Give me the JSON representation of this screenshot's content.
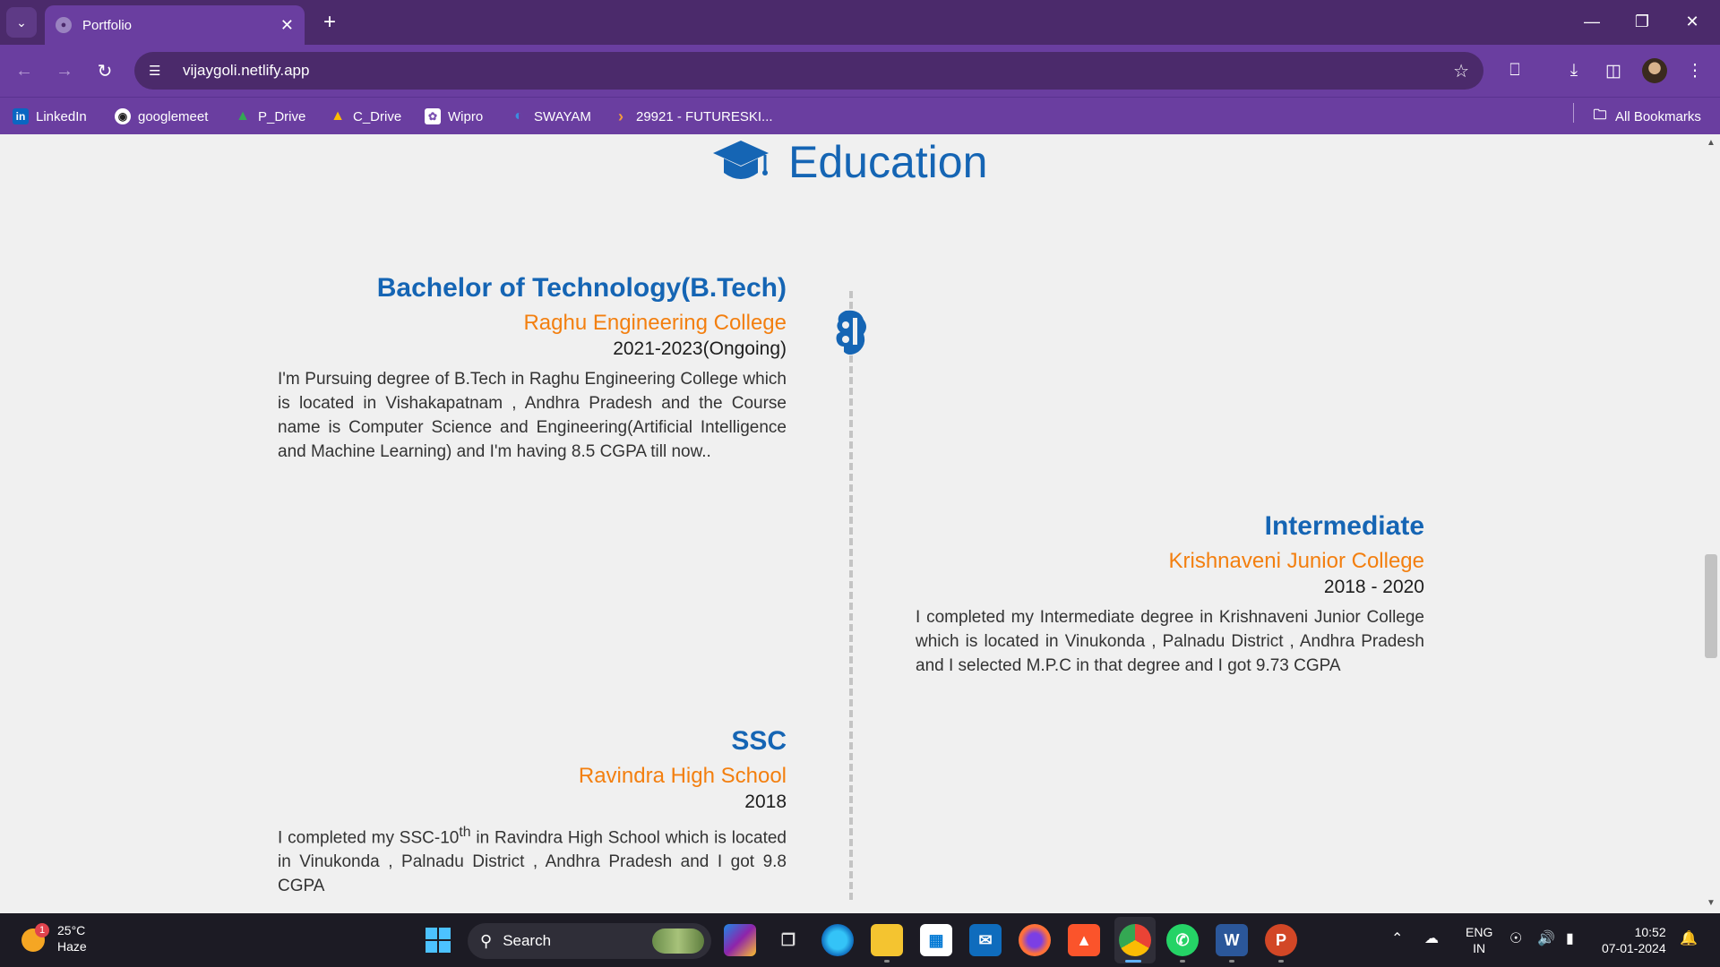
{
  "browser": {
    "tab_title": "Portfolio",
    "url": "vijaygoli.netlify.app",
    "bookmarks": [
      {
        "label": "LinkedIn",
        "icon": "linkedin-icon"
      },
      {
        "label": "googlemeet",
        "icon": "github-icon"
      },
      {
        "label": "P_Drive",
        "icon": "google-drive-icon"
      },
      {
        "label": "C_Drive",
        "icon": "google-drive-icon"
      },
      {
        "label": "Wipro",
        "icon": "wipro-icon"
      },
      {
        "label": "SWAYAM",
        "icon": "swayam-icon"
      },
      {
        "label": "29921 - FUTURESKI...",
        "icon": "chevron-right-icon"
      }
    ],
    "all_bookmarks_label": "All Bookmarks"
  },
  "page": {
    "section_title": "Education",
    "entries": [
      {
        "degree": "Bachelor of Technology(B.Tech)",
        "college": "Raghu Engineering College",
        "years": "2021-2023(Ongoing)",
        "description": "I'm Pursuing degree of B.Tech in Raghu Engineering College which is located in Vishakapatnam , Andhra Pradesh and the Course name is Computer Science and Engineering(Artificial Intelligence and Machine Learning) and I'm having 8.5 CGPA till now.."
      },
      {
        "degree": "Intermediate",
        "college": "Krishnaveni Junior College",
        "years": "2018 - 2020",
        "description": "I completed my Intermediate degree in Krishnaveni Junior College which is located in Vinukonda , Palnadu District , Andhra Pradesh and I selected M.P.C in that degree and I got 9.73 CGPA"
      },
      {
        "degree": "SSC",
        "college": "Ravindra High School",
        "years": "2018",
        "description_before": "I completed my SSC-10",
        "description_sup": "th",
        "description_after": " in Ravindra High School which is located in Vinukonda , Palnadu District , Andhra Pradesh and I got 9.8 CGPA"
      }
    ],
    "accent_color": "#1565b4",
    "college_color": "#f37f0f"
  },
  "taskbar": {
    "weather_temp": "25°C",
    "weather_desc": "Haze",
    "weather_badge": "1",
    "search_placeholder": "Search",
    "lang_line1": "ENG",
    "lang_line2": "IN",
    "time": "10:52",
    "date": "07-01-2024"
  }
}
